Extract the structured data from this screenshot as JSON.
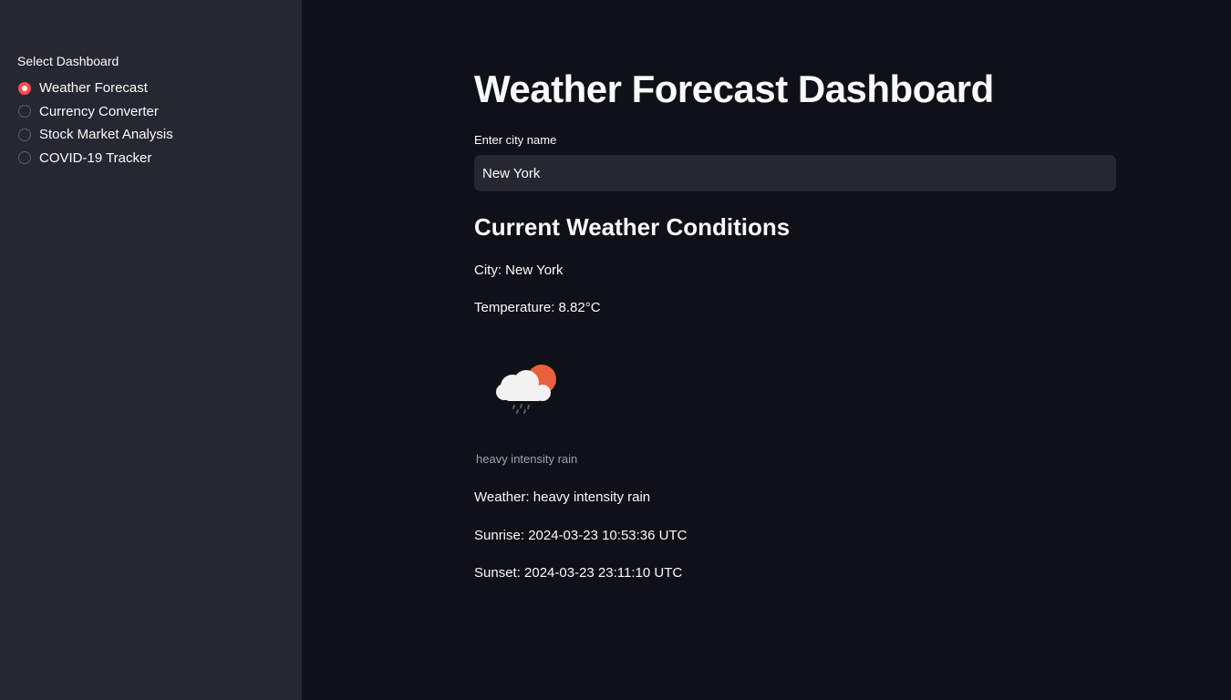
{
  "sidebar": {
    "label": "Select Dashboard",
    "options": [
      {
        "label": "Weather Forecast",
        "selected": true
      },
      {
        "label": "Currency Converter",
        "selected": false
      },
      {
        "label": "Stock Market Analysis",
        "selected": false
      },
      {
        "label": "COVID-19 Tracker",
        "selected": false
      }
    ]
  },
  "main": {
    "title": "Weather Forecast Dashboard",
    "city_input": {
      "label": "Enter city name",
      "value": "New York"
    },
    "section_heading": "Current Weather Conditions",
    "city_line": "City: New York",
    "temperature_line": "Temperature: 8.82°C",
    "weather_icon": "cloud-sun-rain-icon",
    "icon_caption": "heavy intensity rain",
    "weather_line": "Weather: heavy intensity rain",
    "sunrise_line": "Sunrise: 2024-03-23 10:53:36 UTC",
    "sunset_line": "Sunset: 2024-03-23 23:11:10 UTC"
  },
  "colors": {
    "background": "#0e1117",
    "sidebar": "#262730",
    "accent": "#ff4b4b",
    "text": "#fafafa",
    "caption": "#a0a2ab"
  }
}
